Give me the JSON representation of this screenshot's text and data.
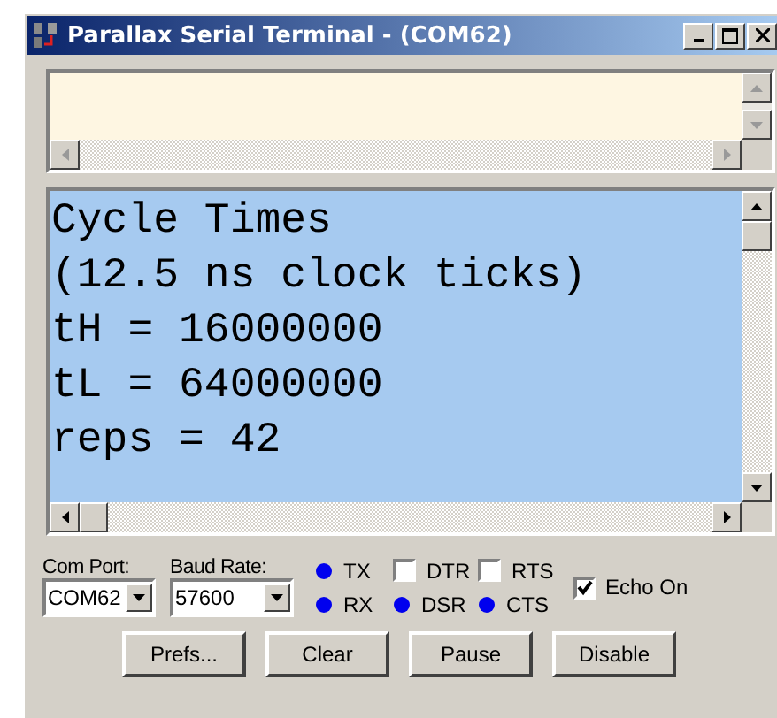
{
  "window": {
    "title": "Parallax Serial Terminal - (COM62)"
  },
  "receive_pane": {
    "lines": [
      "Cycle Times",
      "(12.5 ns clock ticks)",
      "tH = 16000000",
      "tL = 64000000",
      "reps = 42"
    ]
  },
  "com_port": {
    "label": "Com Port:",
    "value": "COM62"
  },
  "baud_rate": {
    "label": "Baud Rate:",
    "value": "57600"
  },
  "signals": [
    {
      "kind": "led",
      "label": "TX",
      "on": true
    },
    {
      "kind": "checkbox",
      "label": "DTR",
      "checked": false
    },
    {
      "kind": "checkbox",
      "label": "RTS",
      "checked": false
    },
    {
      "kind": "led",
      "label": "RX",
      "on": true
    },
    {
      "kind": "led",
      "label": "DSR",
      "on": true
    },
    {
      "kind": "led",
      "label": "CTS",
      "on": true
    }
  ],
  "echo": {
    "label": "Echo On",
    "checked": true
  },
  "buttons": [
    "Prefs...",
    "Clear",
    "Pause",
    "Disable"
  ]
}
